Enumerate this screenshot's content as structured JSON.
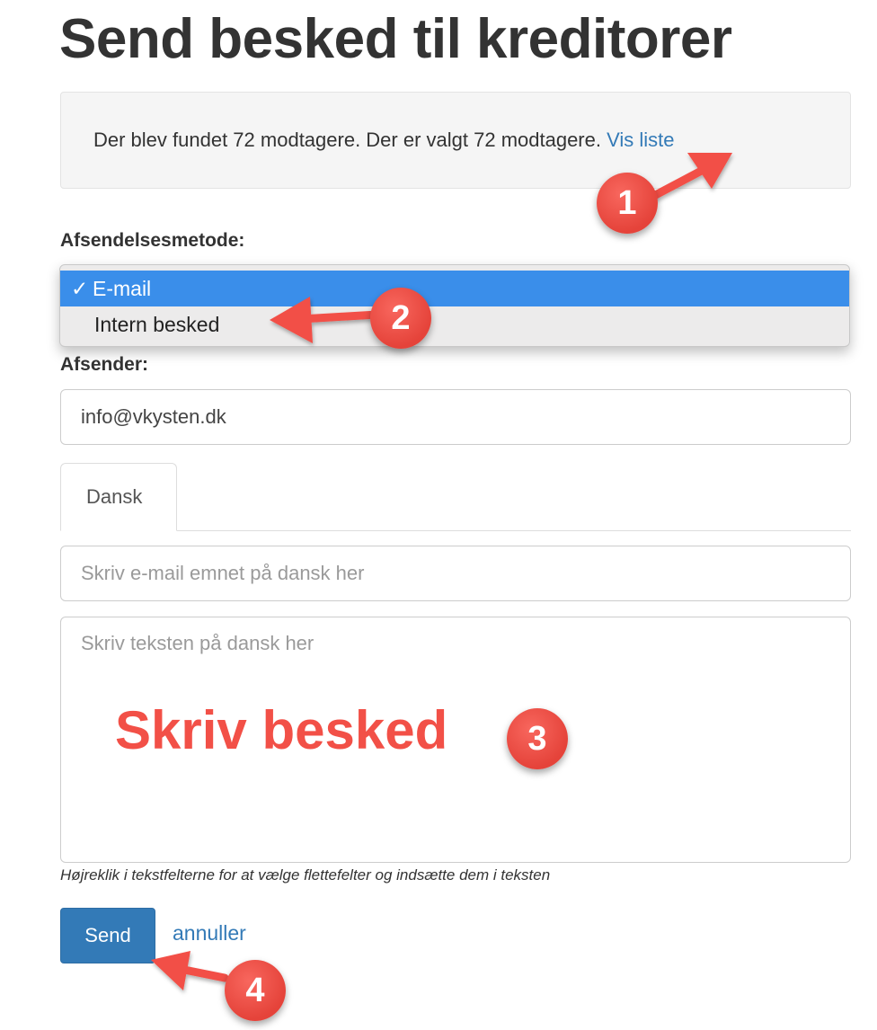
{
  "page": {
    "title": "Send besked til kreditorer"
  },
  "info": {
    "text": "Der blev fundet 72 modtagere. Der er valgt 72 modtagere.",
    "link": "Vis liste"
  },
  "send_method": {
    "label": "Afsendelsesmetode:",
    "check_mark": "✓",
    "options": [
      {
        "label": "E-mail",
        "selected": true
      },
      {
        "label": "Intern besked",
        "selected": false
      }
    ]
  },
  "sender": {
    "label": "Afsender:",
    "value": "info@vkysten.dk"
  },
  "tabs": [
    {
      "label": "Dansk",
      "active": true
    }
  ],
  "subject": {
    "placeholder": "Skriv e-mail emnet på dansk her"
  },
  "body": {
    "placeholder": "Skriv teksten på dansk her"
  },
  "hint": "Højreklik i tekstfelterne for at vælge flettefelter og indsætte dem i teksten",
  "actions": {
    "send": "Send",
    "cancel": "annuller"
  },
  "annotations": {
    "overlay_text": "Skriv besked",
    "steps": [
      "1",
      "2",
      "3",
      "4"
    ],
    "color": "#f25047"
  },
  "colors": {
    "link": "#337ab7",
    "primary": "#337ab7",
    "selected_option": "#3a8eea"
  }
}
